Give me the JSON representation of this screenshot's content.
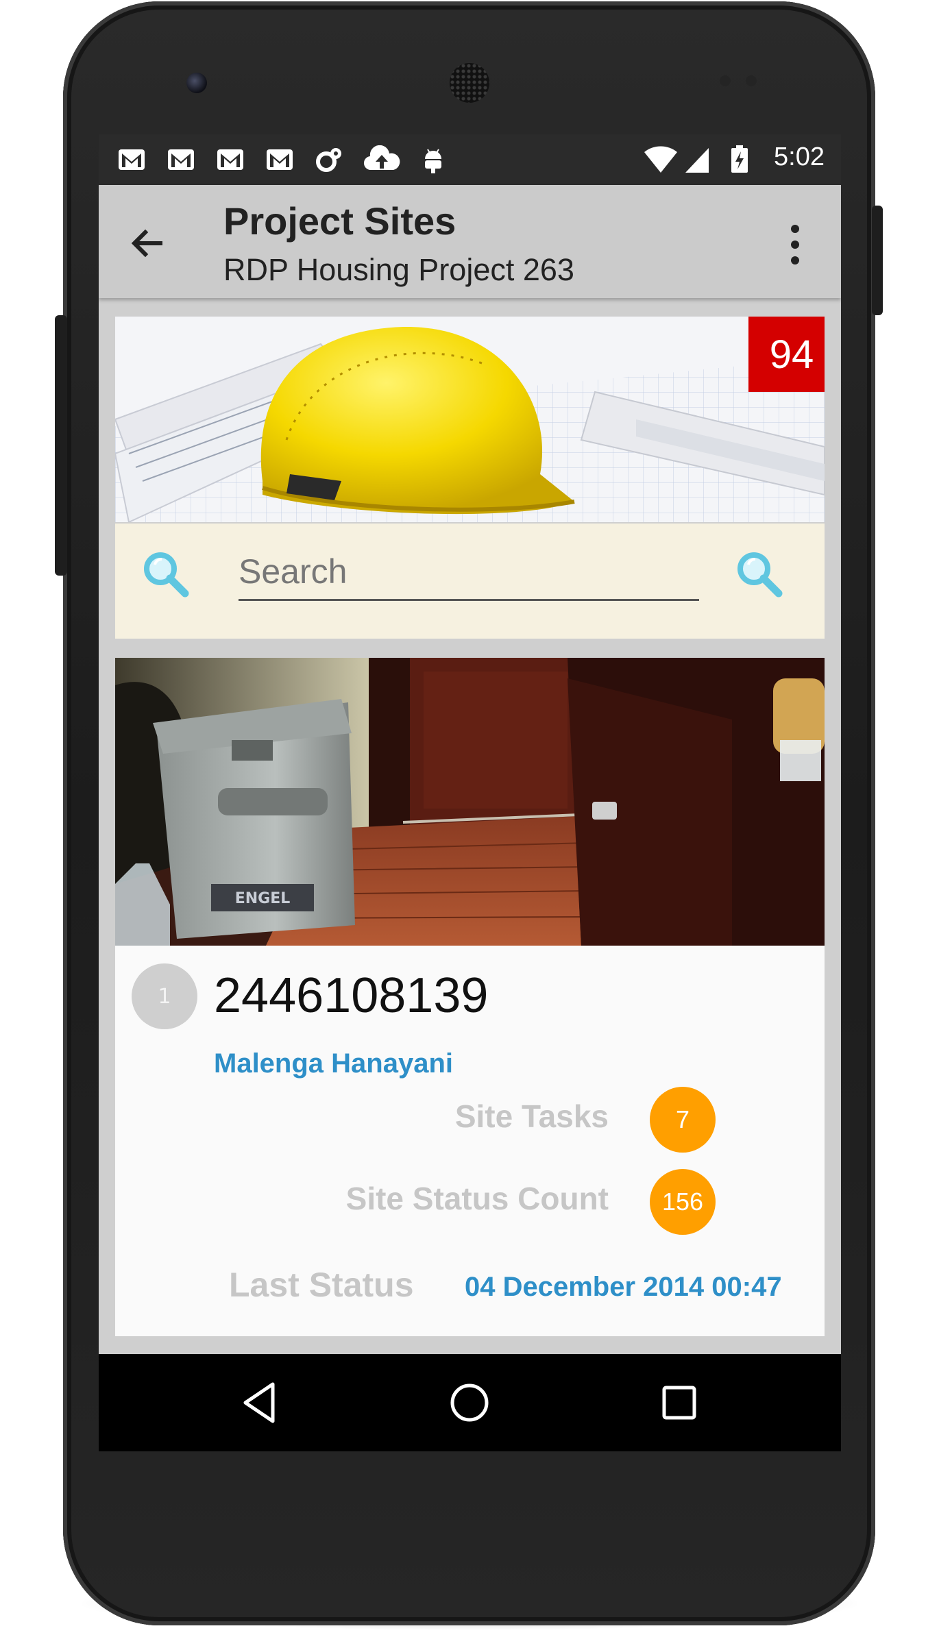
{
  "status_bar": {
    "time": "5:02",
    "icons": [
      "gmail-icon",
      "gmail-icon",
      "gmail-icon",
      "gmail-icon",
      "sync-icon",
      "cloud-upload-icon",
      "android-debug-icon",
      "wifi-icon",
      "signal-icon",
      "battery-charging-icon"
    ]
  },
  "app_bar": {
    "title": "Project Sites",
    "subtitle": "RDP Housing Project 263"
  },
  "banner": {
    "badge": "94"
  },
  "search": {
    "placeholder": "Search"
  },
  "site_card": {
    "index": "1",
    "number": "2446108139",
    "owner": "Malenga Hanayani",
    "tasks_label": "Site Tasks",
    "tasks_count": "7",
    "status_count_label": "Site Status Count",
    "status_count": "156",
    "last_status_label": "Last Status",
    "last_status_value": "04 December 2014 00:47"
  },
  "colors": {
    "accent_blue": "#2e8fc8",
    "badge_red": "#d40000",
    "count_orange": "#ff9f00"
  }
}
